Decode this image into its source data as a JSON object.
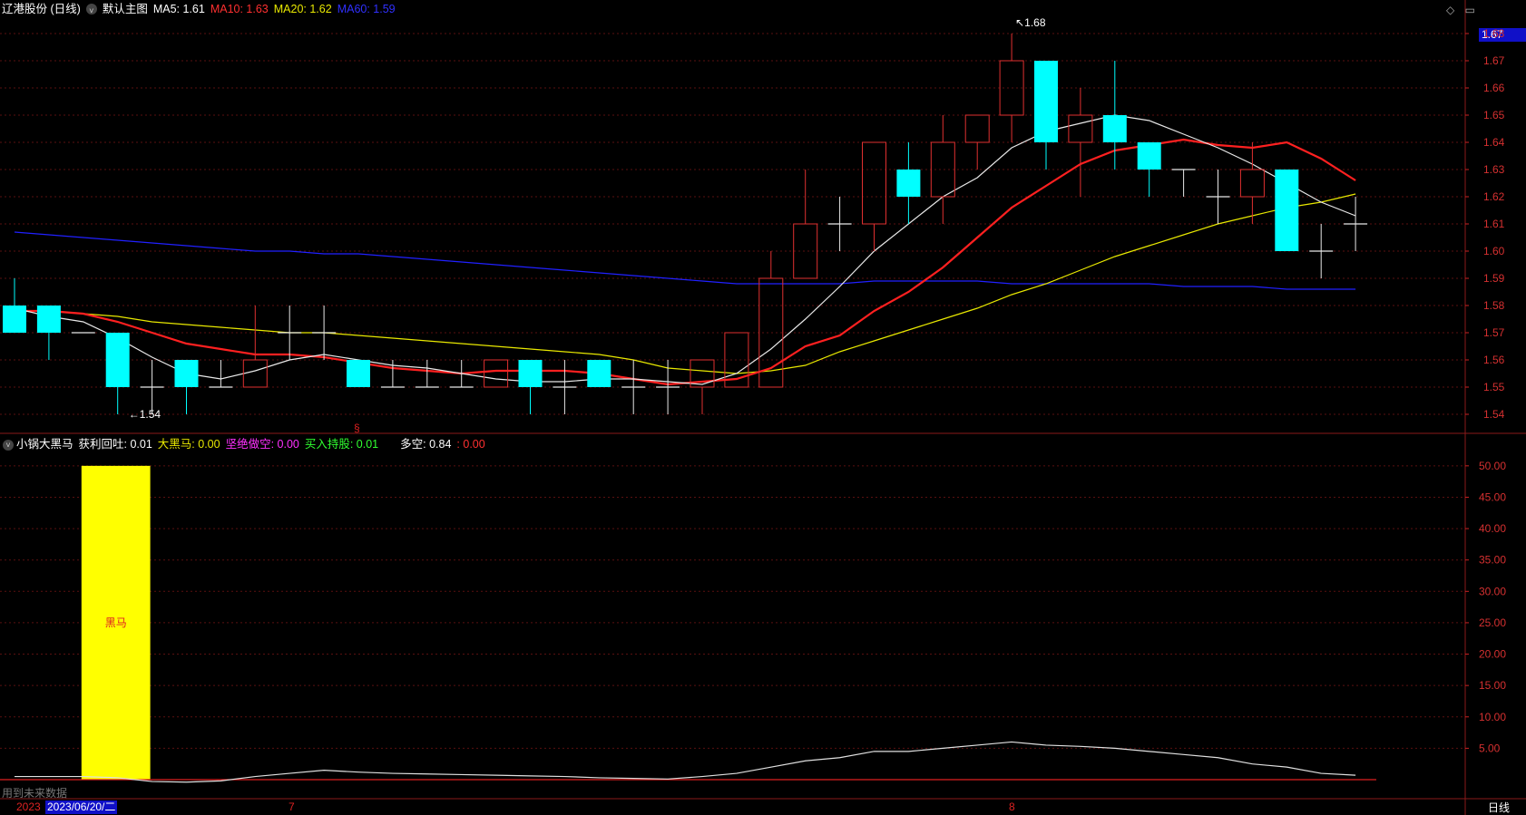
{
  "price_legend": {
    "title": "辽港股份 (日线)",
    "template": "默认主图",
    "ma5": "MA5: 1.61",
    "ma10": "MA10: 1.63",
    "ma20": "MA20: 1.62",
    "ma60": "MA60: 1.59"
  },
  "indicator_legend": {
    "name": "小锅大黑马",
    "profit": "获利回吐: 0.01",
    "horse": "大黑马: 0.00",
    "short": "坚绝做空: 0.00",
    "hold": "买入持股: 0.01",
    "longshort": "多空: 0.84",
    "extra": ": 0.00"
  },
  "colors": {
    "up": "#e03030",
    "down": "#00ffff",
    "ma5": "#e8e8e8",
    "ma10": "#ff2020",
    "ma20": "#e8e800",
    "ma60": "#2020ff",
    "grid": "#5a1010",
    "bar": "#ffff00"
  },
  "sidebar_tag": "1.67",
  "period_button": "日线",
  "date_left": "2023",
  "date_selected": "2023/06/20/二",
  "no_future": "用到未来数据",
  "month_marks": [
    "7",
    "8"
  ],
  "top_icons": "◇ ▭",
  "price_axis": [
    "1.68",
    "1.67",
    "1.66",
    "1.65",
    "1.64",
    "1.63",
    "1.62",
    "1.61",
    "1.60",
    "1.59",
    "1.58",
    "1.57",
    "1.56",
    "1.55",
    "1.54"
  ],
  "indicator_axis": [
    "50.00",
    "45.00",
    "40.00",
    "35.00",
    "30.00",
    "25.00",
    "20.00",
    "15.00",
    "10.00",
    "5.00"
  ],
  "high_label": "1.68",
  "low_label": "1.54",
  "signal_mark": "§",
  "bar_label": "黑马",
  "chart_data": {
    "type": "candlestick",
    "candles": [
      {
        "o": 1.57,
        "c": 1.58,
        "h": 1.59,
        "l": 1.57,
        "dir": "down"
      },
      {
        "o": 1.58,
        "c": 1.57,
        "h": 1.58,
        "l": 1.56,
        "dir": "down"
      },
      {
        "o": 1.57,
        "c": 1.57,
        "h": 1.57,
        "l": 1.57,
        "dir": "flat"
      },
      {
        "o": 1.57,
        "c": 1.55,
        "h": 1.57,
        "l": 1.54,
        "dir": "down"
      },
      {
        "o": 1.55,
        "c": 1.55,
        "h": 1.56,
        "l": 1.54,
        "dir": "flat"
      },
      {
        "o": 1.56,
        "c": 1.55,
        "h": 1.56,
        "l": 1.54,
        "dir": "down"
      },
      {
        "o": 1.55,
        "c": 1.55,
        "h": 1.56,
        "l": 1.55,
        "dir": "flat"
      },
      {
        "o": 1.55,
        "c": 1.56,
        "h": 1.58,
        "l": 1.55,
        "dir": "up"
      },
      {
        "o": 1.57,
        "c": 1.57,
        "h": 1.58,
        "l": 1.56,
        "dir": "flat"
      },
      {
        "o": 1.57,
        "c": 1.57,
        "h": 1.58,
        "l": 1.56,
        "dir": "flat"
      },
      {
        "o": 1.56,
        "c": 1.55,
        "h": 1.56,
        "l": 1.55,
        "dir": "down"
      },
      {
        "o": 1.55,
        "c": 1.55,
        "h": 1.56,
        "l": 1.55,
        "dir": "flat"
      },
      {
        "o": 1.55,
        "c": 1.55,
        "h": 1.56,
        "l": 1.55,
        "dir": "flat"
      },
      {
        "o": 1.55,
        "c": 1.55,
        "h": 1.56,
        "l": 1.55,
        "dir": "flat"
      },
      {
        "o": 1.55,
        "c": 1.56,
        "h": 1.56,
        "l": 1.55,
        "dir": "up"
      },
      {
        "o": 1.56,
        "c": 1.55,
        "h": 1.56,
        "l": 1.54,
        "dir": "down"
      },
      {
        "o": 1.55,
        "c": 1.55,
        "h": 1.56,
        "l": 1.54,
        "dir": "flat"
      },
      {
        "o": 1.56,
        "c": 1.55,
        "h": 1.56,
        "l": 1.55,
        "dir": "down"
      },
      {
        "o": 1.55,
        "c": 1.55,
        "h": 1.56,
        "l": 1.54,
        "dir": "flat"
      },
      {
        "o": 1.55,
        "c": 1.55,
        "h": 1.56,
        "l": 1.54,
        "dir": "flat"
      },
      {
        "o": 1.55,
        "c": 1.56,
        "h": 1.56,
        "l": 1.54,
        "dir": "up"
      },
      {
        "o": 1.55,
        "c": 1.57,
        "h": 1.57,
        "l": 1.55,
        "dir": "up"
      },
      {
        "o": 1.55,
        "c": 1.59,
        "h": 1.6,
        "l": 1.55,
        "dir": "up"
      },
      {
        "o": 1.59,
        "c": 1.61,
        "h": 1.63,
        "l": 1.59,
        "dir": "up"
      },
      {
        "o": 1.61,
        "c": 1.61,
        "h": 1.62,
        "l": 1.6,
        "dir": "flat"
      },
      {
        "o": 1.61,
        "c": 1.64,
        "h": 1.64,
        "l": 1.6,
        "dir": "up"
      },
      {
        "o": 1.63,
        "c": 1.62,
        "h": 1.64,
        "l": 1.61,
        "dir": "down"
      },
      {
        "o": 1.62,
        "c": 1.64,
        "h": 1.65,
        "l": 1.61,
        "dir": "up"
      },
      {
        "o": 1.64,
        "c": 1.65,
        "h": 1.65,
        "l": 1.63,
        "dir": "up"
      },
      {
        "o": 1.65,
        "c": 1.67,
        "h": 1.68,
        "l": 1.64,
        "dir": "up"
      },
      {
        "o": 1.67,
        "c": 1.64,
        "h": 1.67,
        "l": 1.63,
        "dir": "down"
      },
      {
        "o": 1.64,
        "c": 1.65,
        "h": 1.66,
        "l": 1.62,
        "dir": "up"
      },
      {
        "o": 1.65,
        "c": 1.64,
        "h": 1.67,
        "l": 1.63,
        "dir": "down"
      },
      {
        "o": 1.64,
        "c": 1.63,
        "h": 1.64,
        "l": 1.62,
        "dir": "down"
      },
      {
        "o": 1.63,
        "c": 1.63,
        "h": 1.63,
        "l": 1.62,
        "dir": "flat"
      },
      {
        "o": 1.62,
        "c": 1.62,
        "h": 1.63,
        "l": 1.61,
        "dir": "flat"
      },
      {
        "o": 1.62,
        "c": 1.63,
        "h": 1.64,
        "l": 1.61,
        "dir": "up"
      },
      {
        "o": 1.63,
        "c": 1.6,
        "h": 1.63,
        "l": 1.6,
        "dir": "down"
      },
      {
        "o": 1.6,
        "c": 1.6,
        "h": 1.61,
        "l": 1.59,
        "dir": "flat"
      },
      {
        "o": 1.61,
        "c": 1.61,
        "h": 1.62,
        "l": 1.6,
        "dir": "flat"
      }
    ],
    "ma5": [
      1.579,
      1.576,
      1.574,
      1.568,
      1.561,
      1.555,
      1.553,
      1.556,
      1.56,
      1.562,
      1.56,
      1.558,
      1.557,
      1.555,
      1.553,
      1.552,
      1.552,
      1.553,
      1.553,
      1.552,
      1.551,
      1.555,
      1.564,
      1.575,
      1.587,
      1.6,
      1.61,
      1.62,
      1.627,
      1.638,
      1.644,
      1.647,
      1.65,
      1.648,
      1.643,
      1.638,
      1.632,
      1.625,
      1.618,
      1.613
    ],
    "ma10": [
      1.578,
      1.578,
      1.577,
      1.574,
      1.57,
      1.566,
      1.564,
      1.562,
      1.562,
      1.561,
      1.559,
      1.557,
      1.556,
      1.555,
      1.556,
      1.556,
      1.556,
      1.555,
      1.553,
      1.551,
      1.552,
      1.553,
      1.557,
      1.565,
      1.569,
      1.578,
      1.585,
      1.594,
      1.605,
      1.616,
      1.624,
      1.632,
      1.637,
      1.639,
      1.641,
      1.639,
      1.638,
      1.64,
      1.634,
      1.626
    ],
    "ma20": [
      1.578,
      1.578,
      1.577,
      1.576,
      1.574,
      1.573,
      1.572,
      1.571,
      1.57,
      1.57,
      1.569,
      1.568,
      1.567,
      1.566,
      1.565,
      1.564,
      1.563,
      1.562,
      1.56,
      1.557,
      1.556,
      1.555,
      1.556,
      1.558,
      1.563,
      1.567,
      1.571,
      1.575,
      1.579,
      1.584,
      1.588,
      1.593,
      1.598,
      1.602,
      1.606,
      1.61,
      1.613,
      1.616,
      1.618,
      1.621
    ],
    "ma60": [
      1.607,
      1.606,
      1.605,
      1.604,
      1.603,
      1.602,
      1.601,
      1.6,
      1.6,
      1.599,
      1.599,
      1.598,
      1.597,
      1.596,
      1.595,
      1.594,
      1.593,
      1.592,
      1.591,
      1.59,
      1.589,
      1.588,
      1.588,
      1.588,
      1.588,
      1.589,
      1.589,
      1.589,
      1.589,
      1.588,
      1.588,
      1.588,
      1.588,
      1.588,
      1.587,
      1.587,
      1.587,
      1.586,
      1.586,
      1.586
    ],
    "indicator_line": [
      0.5,
      0.5,
      0.5,
      0.3,
      -0.3,
      -0.4,
      -0.2,
      0.5,
      1.0,
      1.5,
      1.2,
      1.0,
      0.9,
      0.8,
      0.7,
      0.6,
      0.5,
      0.3,
      0.2,
      0.1,
      0.5,
      1.0,
      2.0,
      3.0,
      3.5,
      4.5,
      4.5,
      5.0,
      5.5,
      6.0,
      5.5,
      5.3,
      5.0,
      4.5,
      4.0,
      3.5,
      2.5,
      2.0,
      1.0,
      0.7
    ],
    "horse_bar": {
      "candle_start": 2,
      "candle_end": 4,
      "value": 50
    },
    "price_ylim": [
      1.535,
      1.685
    ],
    "indicator_ylim": [
      0,
      52
    ]
  }
}
